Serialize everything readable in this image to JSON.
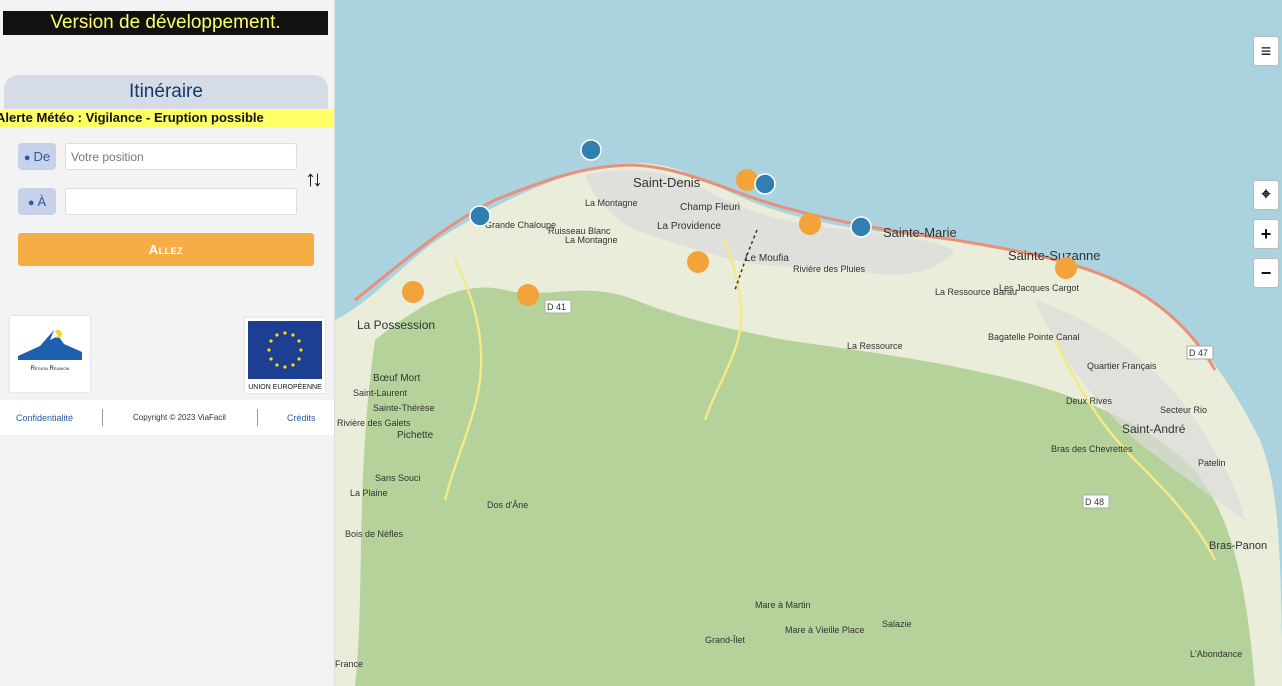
{
  "sidebar": {
    "dev_banner": "Version de développement.",
    "title": "Itinéraire",
    "alert": "Alerte Météo : Vigilance - Eruption possible",
    "from": {
      "label": "De",
      "value": "",
      "placeholder": "Votre position"
    },
    "to": {
      "label": "À",
      "value": "",
      "placeholder": ""
    },
    "go_button": "Allez",
    "logos": {
      "region": "Région Réunion",
      "eu": "UNION EUROPÉENNE"
    },
    "footer": {
      "privacy": "Confidentialité",
      "copyright": "Copyright © 2023 ViaFacil",
      "credits": "Crédits"
    }
  },
  "map": {
    "controls": [
      {
        "name": "menu",
        "icon": "hamburger-icon"
      },
      {
        "name": "locate",
        "icon": "crosshair-icon"
      },
      {
        "name": "zoom-in",
        "icon": "plus-icon"
      },
      {
        "name": "zoom-out",
        "icon": "minus-icon"
      }
    ],
    "towns": [
      "Saint-Denis",
      "La Montagne",
      "Champ Fleuri",
      "La Providence",
      "Ruisseau Blanc",
      "La Montagne",
      "Grande Chaloupe",
      "Le Moufia",
      "Rivière des Pluies",
      "Sainte-Marie",
      "Sainte-Suzanne",
      "La Ressource Barau",
      "Les Jacques Cargot",
      "Bagatelle Pointe Canal",
      "La Ressource",
      "La Possession",
      "Bœuf Mort",
      "Saint-Laurent",
      "Sainte-Thérèse",
      "Rivière des Galets",
      "Pichette",
      "Sans Souci",
      "La Plaine",
      "Dos d'Âne",
      "Bois de Nèfles",
      "Quartier Français",
      "Deux Rives",
      "Secteur Rio",
      "Saint-André",
      "Bras des Chevrettes",
      "Patelin",
      "Bras-Panon",
      "Mare à Martin",
      "Mare à Vieille Place",
      "Grand-Îlet",
      "Salazie",
      "France",
      "L'Abondance"
    ],
    "roads": [
      "D 41",
      "D 47",
      "D 48"
    ],
    "colors": {
      "sea": "#aad3df",
      "land": "#e9edd9",
      "forest": "#b5d29a",
      "urban": "#dcdcdc",
      "warning_marker": "#f2a33a",
      "info_marker": "#2f7fb3"
    }
  }
}
